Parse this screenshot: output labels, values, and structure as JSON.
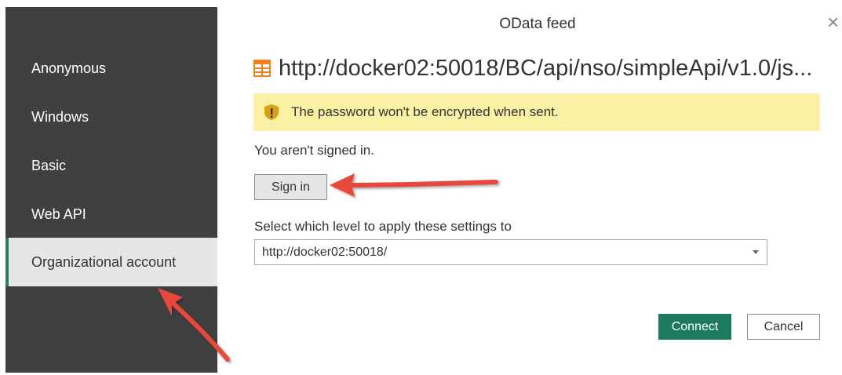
{
  "dialog": {
    "title": "OData feed",
    "close_glyph": "×",
    "url": "http://docker02:50018/BC/api/nso/simpleApi/v1.0/js...",
    "url_icon": "table-icon",
    "warning_icon": "shield-warning-icon",
    "warning_text": "The password won't be encrypted when sent.",
    "signin_status": "You aren't signed in.",
    "signin_label": "Sign in",
    "level_label": "Select which level to apply these settings to",
    "level_value": "http://docker02:50018/",
    "connect_label": "Connect",
    "cancel_label": "Cancel"
  },
  "sidebar": {
    "items": [
      {
        "label": "Anonymous",
        "selected": false
      },
      {
        "label": "Windows",
        "selected": false
      },
      {
        "label": "Basic",
        "selected": false
      },
      {
        "label": "Web API",
        "selected": false
      },
      {
        "label": "Organizational account",
        "selected": true
      }
    ]
  },
  "colors": {
    "sidebar_bg": "#404040",
    "sidebar_selected_bg": "#e6e6e6",
    "warning_bg": "#fbf1a4",
    "connect_bg": "#1e7a5f",
    "annotation_arrow": "#e8473a"
  }
}
